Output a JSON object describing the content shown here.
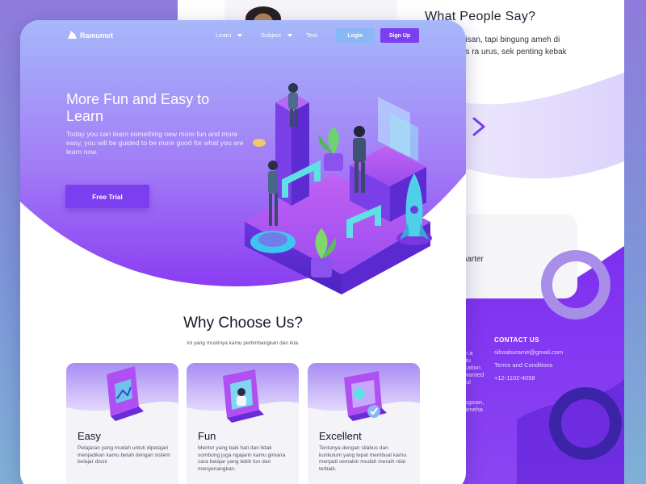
{
  "back_page": {
    "testimonials_title": "What People Say?",
    "testimonial_lines": [
      "tulisan, tapi bingung ameh di",
      "ses ra urus, sek penting kebak"
    ],
    "feature_fragment": "marter",
    "footer": {
      "contact_heading": "CONTACT US",
      "email": "sihoaburame@gmail.com",
      "terms": "Terms and Conditions",
      "phone": "+12-1102-4058",
      "fragments": [
        "n a",
        "itu",
        "cation",
        "wanted",
        "ful"
      ],
      "fragments_2": [
        "ogisan,",
        "ameha"
      ]
    }
  },
  "header": {
    "logo_text": "Ramumet",
    "nav": [
      {
        "label": "Learn"
      },
      {
        "label": "Subject"
      },
      {
        "label": "Test"
      }
    ],
    "login_label": "Login",
    "signup_label": "Sign Up"
  },
  "hero": {
    "title": "More Fun and Easy to Learn",
    "description": "Today you can learn something new more fun and more easy, you will be guided to be more good for what you are learn now.",
    "cta_label": "Free Trial"
  },
  "why": {
    "title": "Why Choose Us?",
    "subtitle": "Ini yang mustinya kamu pertimbangkan dan kita.",
    "cards": [
      {
        "title": "Easy",
        "description": "Pelajaran yang mudah untuk dipelajari menjadikan kamu betah dengan sistem belajar disini"
      },
      {
        "title": "Fun",
        "description": "Mentor yang baik hati dan tidak sombong juga ngajarin kamu gimana cara belajar yang lebih fun dan menyenangkan."
      },
      {
        "title": "Excellent",
        "description": "Tentunya dengan silabus dan kurikulum yang tepat membuat kamu menjadi semakin mudah meraih nilai terbaik."
      }
    ]
  },
  "colors": {
    "primary": "#7b3ff0",
    "login_button": "#8ab8f4",
    "hero_top": "#a6b8fa",
    "hero_bottom": "#8a3df2"
  },
  "icons": [
    "rocket-icon",
    "chevron-right-icon",
    "caret-down-icon",
    "logo-mark-icon"
  ]
}
